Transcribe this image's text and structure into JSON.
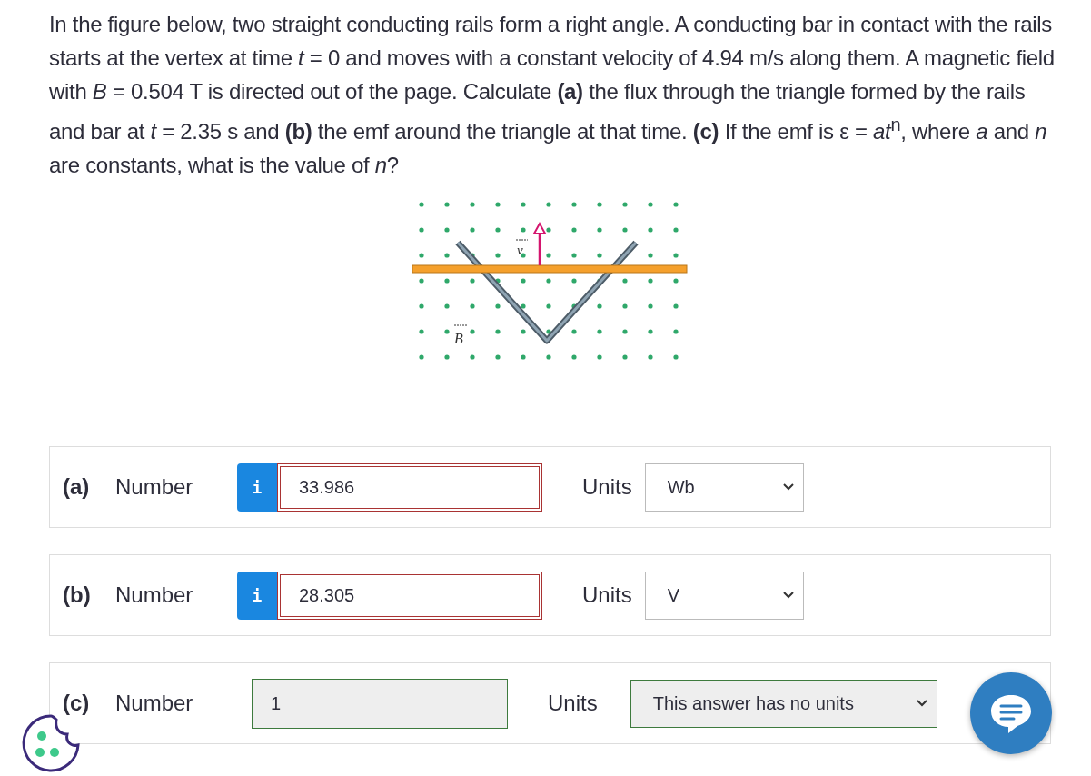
{
  "question": "In the figure below, two straight conducting rails form a right angle. A conducting bar in contact with the rails starts at the vertex at time *t* = 0 and moves with a constant velocity of 4.94 m/s along them. A magnetic field with *B* = 0.504 T is directed out of the page. Calculate **(a)** the flux through the triangle formed by the rails and bar at *t* = 2.35 s and **(b)** the emf around the triangle at that time. **(c)** If the emf is ε = *at*$^{n}$, where *a* and *n* are constants, what is the value of *n*?",
  "figure": {
    "velocity_label": "v",
    "field_label": "B"
  },
  "answers": [
    {
      "part": "(a)",
      "label": "Number",
      "info": "i",
      "value": "33.986",
      "incorrect": true,
      "disabled": false,
      "units_label": "Units",
      "units": "Wb",
      "units_confirmed": false
    },
    {
      "part": "(b)",
      "label": "Number",
      "info": "i",
      "value": "28.305",
      "incorrect": true,
      "disabled": false,
      "units_label": "Units",
      "units": "V",
      "units_confirmed": false
    },
    {
      "part": "(c)",
      "label": "Number",
      "value": "1",
      "incorrect": false,
      "disabled": true,
      "units_label": "Units",
      "units": "This answer has no units",
      "units_confirmed": true
    }
  ]
}
